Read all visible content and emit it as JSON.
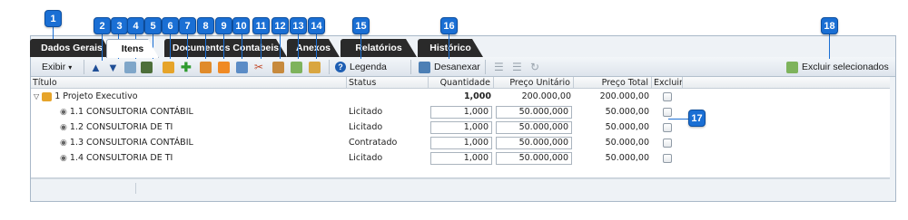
{
  "tabs": [
    "Dados Gerais",
    "Itens",
    "Documentos Contabeis",
    "Anexos",
    "Relatórios",
    "Histórico"
  ],
  "toolbar": {
    "exibir": "Exibir",
    "legenda": "Legenda",
    "desanexar": "Desanexar",
    "excluir_selecionados": "Excluir selecionados"
  },
  "columns": [
    "Título",
    "Status",
    "Quantidade",
    "Preço Unitário",
    "Preço Total",
    "Excluir"
  ],
  "rows": [
    {
      "title": "1 Projeto Executivo",
      "status": "",
      "quantidade": "1,000",
      "preco_unitario": "200.000,00",
      "preco_total": "200.000,00"
    },
    {
      "title": "1.1 CONSULTORIA CONTÁBIL",
      "status": "Licitado",
      "quantidade": "1,000",
      "preco_unitario": "50.000,000",
      "preco_total": "50.000,00"
    },
    {
      "title": "1.2 CONSULTORIA DE TI",
      "status": "Licitado",
      "quantidade": "1,000",
      "preco_unitario": "50.000,000",
      "preco_total": "50.000,00"
    },
    {
      "title": "1.3 CONSULTORIA CONTÁBIL",
      "status": "Contratado",
      "quantidade": "1,000",
      "preco_unitario": "50.000,000",
      "preco_total": "50.000,00"
    },
    {
      "title": "1.4 CONSULTORIA DE TI",
      "status": "Licitado",
      "quantidade": "1,000",
      "preco_unitario": "50.000,000",
      "preco_total": "50.000,00"
    }
  ],
  "badges": [
    "1",
    "2",
    "3",
    "4",
    "5",
    "6",
    "7",
    "8",
    "9",
    "10",
    "11",
    "12",
    "13",
    "14",
    "15",
    "16",
    "17",
    "18"
  ],
  "colors": {
    "badge": "#1a6fd4",
    "tab_dark": "#2a2a2a"
  }
}
